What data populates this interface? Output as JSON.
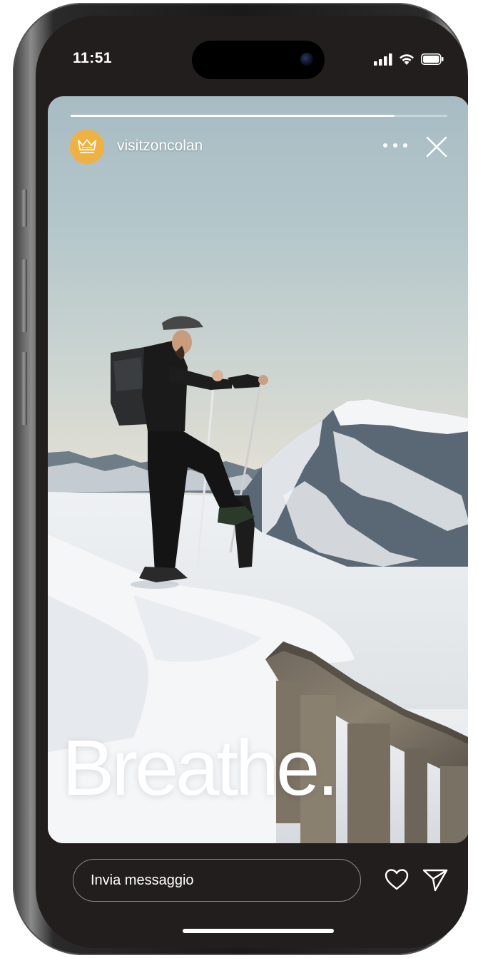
{
  "status_bar": {
    "time": "11:51"
  },
  "story": {
    "progress": 0.86,
    "username": "visitzoncolan",
    "caption": "Breathe.",
    "avatar_color": "#f0b13e",
    "avatar_icon": "crown-icon"
  },
  "footer": {
    "message_placeholder": "Invia messaggio",
    "like_icon": "heart-icon",
    "send_icon": "paper-plane-icon"
  },
  "colors": {
    "screen_bg": "#231e1e",
    "text": "#ffffff"
  }
}
